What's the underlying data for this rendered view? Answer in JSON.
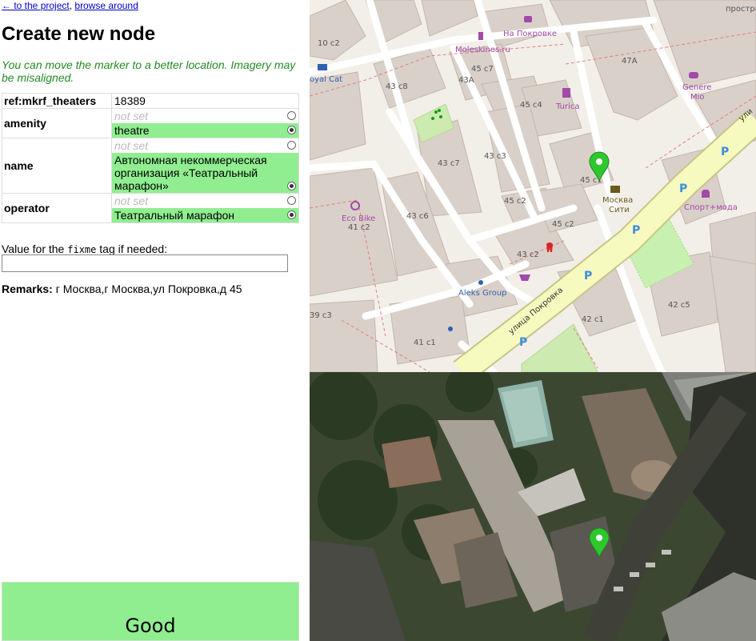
{
  "nav": {
    "back_link": "← to the project",
    "separator": ", ",
    "browse_link": "browse around"
  },
  "title": "Create new node",
  "hint": "You can move the marker to a better location. Imagery may be misaligned.",
  "tags": [
    {
      "key": "ref:mkrf_theaters",
      "value": "18389"
    },
    {
      "key": "amenity",
      "options": [
        {
          "text": "not set",
          "selected": false
        },
        {
          "text": "theatre",
          "selected": true
        }
      ]
    },
    {
      "key": "name",
      "options": [
        {
          "text": "not set",
          "selected": false
        },
        {
          "text": "Автономная некоммерческая организация «Театральный марафон»",
          "selected": true
        }
      ]
    },
    {
      "key": "operator",
      "options": [
        {
          "text": "not set",
          "selected": false
        },
        {
          "text": "Театральный марафон",
          "selected": true
        }
      ]
    }
  ],
  "fixme": {
    "label_before": "Value for the ",
    "tag": "fixme",
    "label_after": " tag if needed:",
    "value": ""
  },
  "remarks": {
    "label": "Remarks:",
    "text": " г Москва,г Москва,ул Покровка,д 45"
  },
  "good_button": "Good",
  "map": {
    "labels": {
      "na_pokrovke": "На Покровке",
      "prostran": "простран",
      "moleskines": "Moleskines.ru",
      "genere_mio": "Genere",
      "genere_mio2": "Mio",
      "royal_cat": "oyal Cat",
      "turica": "Turica",
      "moskva_siti": "Москва",
      "moskva_siti2": "Сити",
      "sport_moda": "Спорт+мода",
      "eco_bike": "Eco Bike",
      "aleks_group": "Aleks Group",
      "street": "улица Покровка",
      "street_top": "ули"
    },
    "house_numbers": [
      "10 с2",
      "43 с8",
      "45 с7",
      "43А",
      "45 с4",
      "47А",
      "43 с3",
      "43 с7",
      "45 с2",
      "45 с1",
      "43 с6",
      "41 с2",
      "45 с2",
      "43 с2",
      "42 с1",
      "42 с5",
      "41 с1",
      "39 с3"
    ]
  },
  "colors": {
    "selected": "#90ee90",
    "hint": "#228b22",
    "marker": "#2ec82e",
    "road_main": "#f7fabf"
  }
}
